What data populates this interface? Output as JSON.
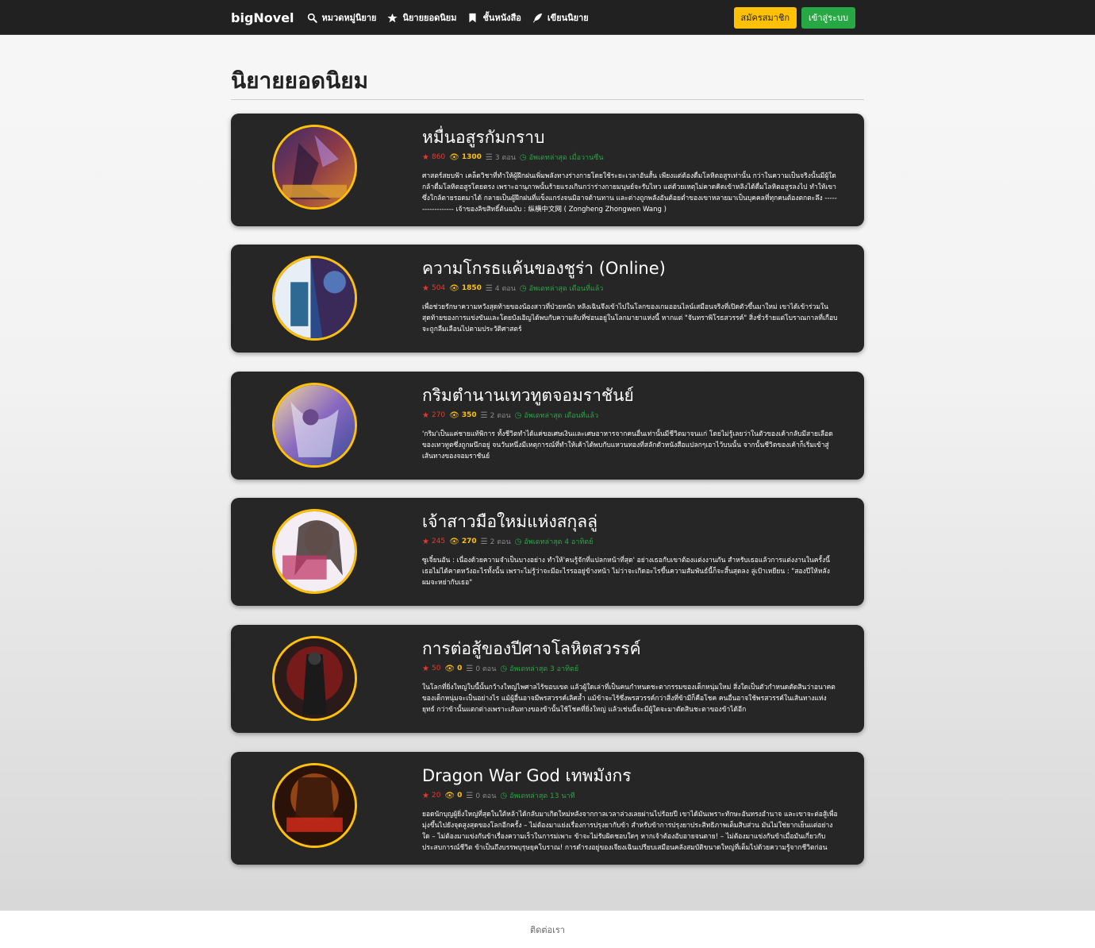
{
  "nav": {
    "brand": "bigNovel",
    "links": [
      {
        "label": "หมวดหมู่นิยาย",
        "icon": "search-icon"
      },
      {
        "label": "นิยายยอดนิยม",
        "icon": "star-icon"
      },
      {
        "label": "ชั้นหนังสือ",
        "icon": "bookmark-icon"
      },
      {
        "label": "เขียนนิยาย",
        "icon": "feather-icon"
      }
    ],
    "register_label": "สมัครสมาชิก",
    "login_label": "เข้าสู่ระบบ"
  },
  "page": {
    "title": "นิยายยอดนิยม"
  },
  "colors": {
    "accent_yellow": "#ffc107",
    "accent_green": "#28a745",
    "rating_red": "#e53935",
    "card_bg": "#262626",
    "nav_bg": "#212121"
  },
  "novels": [
    {
      "title": "หมื่นอสูรกัมกราบ",
      "rating": "860",
      "views": "1300",
      "chapters": "3 ตอน",
      "updated": "อัพเดทล่าสุด เมื่อวานซืน",
      "description": "ศาสตร์สยบฟ้า เคล็ดวิชาที่ทำให้ผู้ฝึกฝนเพิ่มพลังทางร่างกายโดยใช้ระยะเวลาอันสั้น เพียงแต่ต้องดื่มโลหิตอสูรเท่านั้น กว่าในความเป็นจริงนั้นมีผู้ใดกล้าดื่มโลหิตอสูรโดยตรง เพราะอานุภาพนั้นร้ายแรงเกินกว่าร่างกายมนุษย์จะรับไหว แต่ด้วยเหตุไม่คาดคิดเข้าหลิงได้ดื่มโลหิตอสูรลงไป ทำให้เขาซึ่งใกล้ตายรอดมาได้ กลายเป็นผู้ฝึกฝนที่แข็งแกร่งจนมิอาจต้านทาน และต่างถูกพลังอันต้อยต่ำของเขาหลายมาเป็นบุคคลที่ทุกคนต้องตกตะลึง ------------------ เจ้าของลิขสิทธิ์ต้นฉบับ : 纵横中文网 ( Zongheng Zhongwen Wang )"
    },
    {
      "title": "ความโกรธแค้นของชูร่า (Online)",
      "rating": "504",
      "views": "1850",
      "chapters": "4 ตอน",
      "updated": "อัพเดทล่าสุด เดือนที่แล้ว",
      "description": "เพื่อช่วยรักษาความหวังสุดท้ายของน้องสาวที่ป่วยหนัก หลิงเฉินจึงเข้าไปในโลกของเกมออนไลน์เสมือนจริงที่เปิดตัวขึ้นมาใหม่ เขาได้เข้าร่วมในสุดท้ายของการแข่งขันและโดยบังเอิญได้พบกับความลับที่ซ่อนอยู่ในโลกมายาแห่งนี้ หากแต่ \"จันทราพิโรธสวรรค์\" สิ่งชั่วร้ายแต่โบราณกาลที่เกือบจะถูกลืมเลือนไปตามประวัติศาสตร์"
    },
    {
      "title": "กริมตำนานเทวทูตจอมราชันย์",
      "rating": "270",
      "views": "350",
      "chapters": "2 ตอน",
      "updated": "อัพเดทล่าสุด เดือนที่แล้ว",
      "description": "'กริม'เป็นแค่ชายแท้พิการ ทั้งชีวิตทำได้แค่ขอเศษเงินและเศษอาหารจากคนอื่นเท่านั้นมีชีวิตมาจนแก่ โดยไม่รู้เลยว่าในตัวของเค้ากลับมีสายเลือดของเทวทูตซึ่งถูกผนึกอยู่ จนวันหนึ่งมีเหตุการณ์ที่ทำให้เค้าได้พบกับแหวนทองที่สลักตัวหนังสือแปลกๆเอาไว้บนนั้น จากนั้นชีวิตของเค้าก็เริ่มเข้าสู่เส้นทางของจอมราชันย์"
    },
    {
      "title": "เจ้าสาวมือใหม่แห่งสกุลลู่",
      "rating": "245",
      "views": "270",
      "chapters": "2 ตอน",
      "updated": "อัพเดทล่าสุด 4 อาทิตย์",
      "description": "ซูเจี๋ยนอัน : เนื่องด้วยความจำเป็นบางอย่าง ทำให้'คนรู้จักที่แปลกหน้าที่สุด' อย่างเธอกับเขาต้องแต่งงานกัน สำหรับเธอแล้วการแต่งงานในครั้งนี้ เธอไม่ได้คาดหวังอะไรทั้งนั้น เพราะไม่รู้ว่าจะมีอะไรรออยู่ข้างหน้า ไม่ว่าจะเกิดอะไรขึ้นความสัมพันธ์นี้ก็จะสิ้นสุดลง ลู่เป้าเหยียน : \"สองปีให้หลัง ผมจะหย่ากับเธอ\""
    },
    {
      "title": "การต่อสู้ของปีศาจโลหิตสวรรค์",
      "rating": "50",
      "views": "0",
      "chapters": "0 ตอน",
      "updated": "อัพเดทล่าสุด 3 อาทิตย์",
      "description": "ในโลกที่ยิ่งใหญ่ใบนี้นั้นกว้างใหญ่ไพศาลไร้ขอบเขต แล้วผู้ใดเล่าที่เป็นคนกำหนดชะตากรรมของเด็กหนุ่มใหม่ สิ่งใดเป็นตัวกำหนดตัดสินว่าอนาคตของเด็กหนุ่มจะเป็นอย่างไร แม้ผู้อื่นอาจมีพรสวรรค์เลิศล้ำ แม้ข้าจะไร้ซึ่งพรสวรรค์กว่าสิ่งที่ข้ามีก็คือโชค คนอื่นอาจใช้พรสวรรค์ในเส้นทางแห่งยุทธ์ กว่าข้านั้นแตกต่างเพราะเส้นทางของข้านั้นใช้โชคที่ยิ่งใหญ่ แล้วเช่นนี้จะมีผู้ใดจะมาตัดสินชะตาของข้าได้อีก"
    },
    {
      "title": "Dragon War God เทพมังกร",
      "rating": "20",
      "views": "0",
      "chapters": "0 ตอน",
      "updated": "อัพเดทล่าสุด 13 นาที",
      "description": "ยอดนักบุญผู้ยิ่งใหญ่ที่สุดในใต้หล้าได้กลับมาเกิดใหม่หลังจากกาลเวลาล่วงเลยผ่านไปร้อยปี เขาได้มันเพราะทักษะอันทรงอำนาจ และเขาจะต่อสู้เพื่อมุ่งขึ้นไปยังจุดสูงสุดของโลกอีกครั้ง – ไม่ต้องมาแย่งเรื่องการปรุงยากับข้า สำหรับข้าการปรุงยาประสิทธิภาพเต็มสิบส่วน มันไม่ใช่ยากเย็นแต่อย่างใด – ไม่ต้องมาแข่งกันข้าเรื่องความเร็วในการม่เพาะ ข้าจะไม่รับผิดชอบใดๆ หากเจ้าต้องอับอายจนตาย! – ไม่ต้องมาแข่งกันข้าเมื่อมันเกี่ยวกับประสบการณ์ชีวิต ข้าเป็นถึงบรรพบุรุษยุคโบราณ! การดำรงอยู่ของเจียงเฉินเปรียบเสมือนคลังสมบัติขนาดใหญ่ที่เต็มไปด้วยความรู้จากชีวิตก่อน"
    }
  ],
  "footer": {
    "contact_label": "ติดต่อเรา"
  }
}
